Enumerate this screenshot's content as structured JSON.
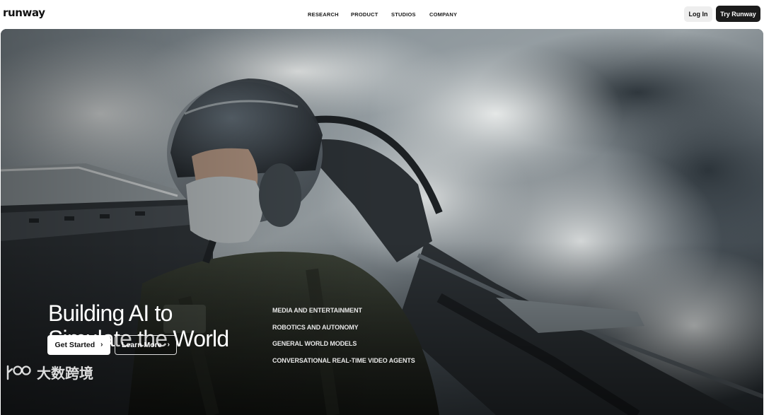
{
  "brand": {
    "logo": "runway"
  },
  "nav": {
    "items": [
      {
        "label": "RESEARCH"
      },
      {
        "label": "PRODUCT"
      },
      {
        "label": "STUDIOS"
      },
      {
        "label": "COMPANY"
      }
    ]
  },
  "auth": {
    "login_label": "Log In",
    "try_label": "Try Runway"
  },
  "hero": {
    "headline_line1": "Building AI to",
    "headline_line2": "Simulate the World",
    "links": [
      {
        "label": "MEDIA AND ENTERTAINMENT"
      },
      {
        "label": "ROBOTICS AND AUTONOMY"
      },
      {
        "label": "GENERAL WORLD MODELS"
      },
      {
        "label": "CONVERSATIONAL REAL-TIME VIDEO AGENTS"
      }
    ],
    "primary_cta": "Get Started",
    "secondary_cta": "Learn More",
    "chevron_icon": "chevron-right-icon",
    "image_subject": "pilot in fighter jet cockpit above clouds"
  },
  "watermark": {
    "text": "大数跨境"
  },
  "colors": {
    "accent_dark": "#1b1b1b",
    "login_bg": "#eeeeee",
    "text_light": "#ffffff"
  }
}
